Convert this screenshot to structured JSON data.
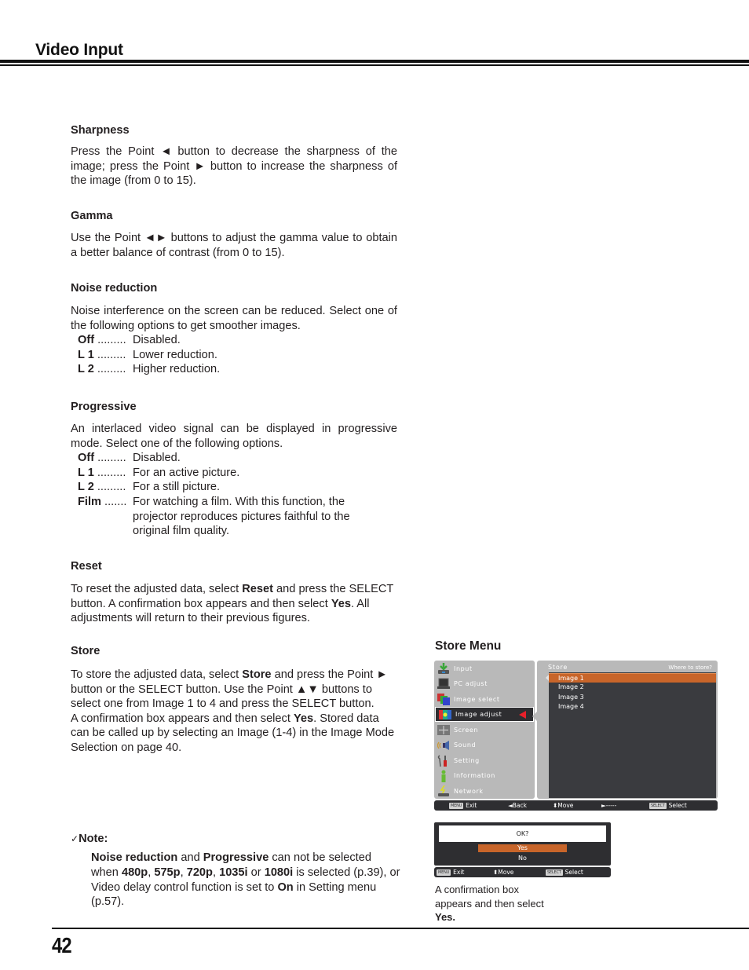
{
  "header": {
    "title": "Video Input"
  },
  "sections": {
    "sharpness": {
      "heading": "Sharpness",
      "body": "Press the Point ◄ button to decrease the sharpness of the image; press the Point ► button to increase the sharpness of the image (from 0 to 15)."
    },
    "gamma": {
      "heading": "Gamma",
      "body": "Use the Point ◄► buttons to adjust the gamma value to obtain a better balance of contrast (from 0 to 15)."
    },
    "noise_reduction": {
      "heading": "Noise reduction",
      "body": "Noise interference on the screen can be reduced. Select one of the following options to get smoother images.",
      "options": [
        {
          "key": "Off",
          "dots": " .........",
          "desc": "Disabled."
        },
        {
          "key": "L 1",
          "dots": " .........",
          "desc": "Lower reduction."
        },
        {
          "key": "L 2",
          "dots": " .........",
          "desc": "Higher reduction."
        }
      ]
    },
    "progressive": {
      "heading": "Progressive",
      "body": "An interlaced video signal can be displayed in progressive mode. Select one of the following options.",
      "options": [
        {
          "key": "Off",
          "dots": " .........",
          "desc": "Disabled."
        },
        {
          "key": "L 1",
          "dots": " .........",
          "desc": "For an active picture."
        },
        {
          "key": "L 2",
          "dots": " .........",
          "desc": "For a still picture."
        },
        {
          "key": "Film",
          "dots": " .......",
          "desc": "For watching a film. With this function, the projector reproduces pictures faithful to the original film quality."
        }
      ]
    },
    "reset": {
      "heading": "Reset",
      "body_1": "To reset the adjusted data, select ",
      "body_bold_1": "Reset",
      "body_2": " and press the SELECT button. A confirmation box appears and then select ",
      "body_bold_2": "Yes",
      "body_3": ". All adjustments will return to their previous figures."
    },
    "store": {
      "heading": "Store",
      "body_1": "To store the adjusted data, select ",
      "body_bold_1": "Store",
      "body_2": " and press the Point ► button or the SELECT button. Use the Point ▲▼ buttons to select one from Image 1 to 4 and press the SELECT button.",
      "body_3": "A confirmation box appears and then select ",
      "body_bold_2": "Yes",
      "body_4": ". Stored data can be called up by selecting an Image (1-4) in the Image Mode Selection on page 40."
    }
  },
  "note": {
    "check_icon": "✓",
    "heading": "Note:",
    "parts": [
      {
        "t": "Noise reduction",
        "b": true
      },
      {
        "t": " and ",
        "b": false
      },
      {
        "t": "Progressive",
        "b": true
      },
      {
        "t": " can not be selected when ",
        "b": false
      },
      {
        "t": "480p",
        "b": true
      },
      {
        "t": ", ",
        "b": false
      },
      {
        "t": "575p",
        "b": true
      },
      {
        "t": ", ",
        "b": false
      },
      {
        "t": "720p",
        "b": true
      },
      {
        "t": ", ",
        "b": false
      },
      {
        "t": "1035i",
        "b": true
      },
      {
        "t": " or ",
        "b": false
      },
      {
        "t": "1080i",
        "b": true
      },
      {
        "t": " is selected (p.39), or Video delay control function is set to ",
        "b": false
      },
      {
        "t": "On",
        "b": true
      },
      {
        "t": " in Setting menu (p.57).",
        "b": false
      }
    ]
  },
  "store_menu": {
    "caption": "Store Menu",
    "main_menu": [
      {
        "label": "Input",
        "icon": "input-icon",
        "active": false
      },
      {
        "label": "PC adjust",
        "icon": "pc-adjust-icon",
        "active": false
      },
      {
        "label": "Image select",
        "icon": "image-select-icon",
        "active": false
      },
      {
        "label": "Image adjust",
        "icon": "image-adjust-icon",
        "active": true
      },
      {
        "label": "Screen",
        "icon": "screen-icon",
        "active": false
      },
      {
        "label": "Sound",
        "icon": "sound-icon",
        "active": false
      },
      {
        "label": "Setting",
        "icon": "setting-icon",
        "active": false
      },
      {
        "label": "Information",
        "icon": "information-icon",
        "active": false
      },
      {
        "label": "Network",
        "icon": "network-icon",
        "active": false
      }
    ],
    "submenu": {
      "title": "Store",
      "hint": "Where to store?",
      "items": [
        "Image 1",
        "Image 2",
        "Image 3",
        "Image 4"
      ],
      "selected": "Image 1"
    },
    "guide_bar": {
      "exit_key": "MENU",
      "exit": "Exit",
      "back": "◄Back",
      "move": "⬍Move",
      "next": "►-----",
      "select_key": "SELECT",
      "select": "Select"
    }
  },
  "confirm_box": {
    "question": "OK?",
    "yes": "Yes",
    "no": "No",
    "guide_bar": {
      "exit_key": "MENU",
      "exit": "Exit",
      "move": "⬍Move",
      "select_key": "SELECT",
      "select": "Select"
    },
    "caption_1": "A confirmation box appears and then select ",
    "caption_bold": "Yes."
  },
  "footer": {
    "page_number": "42"
  }
}
